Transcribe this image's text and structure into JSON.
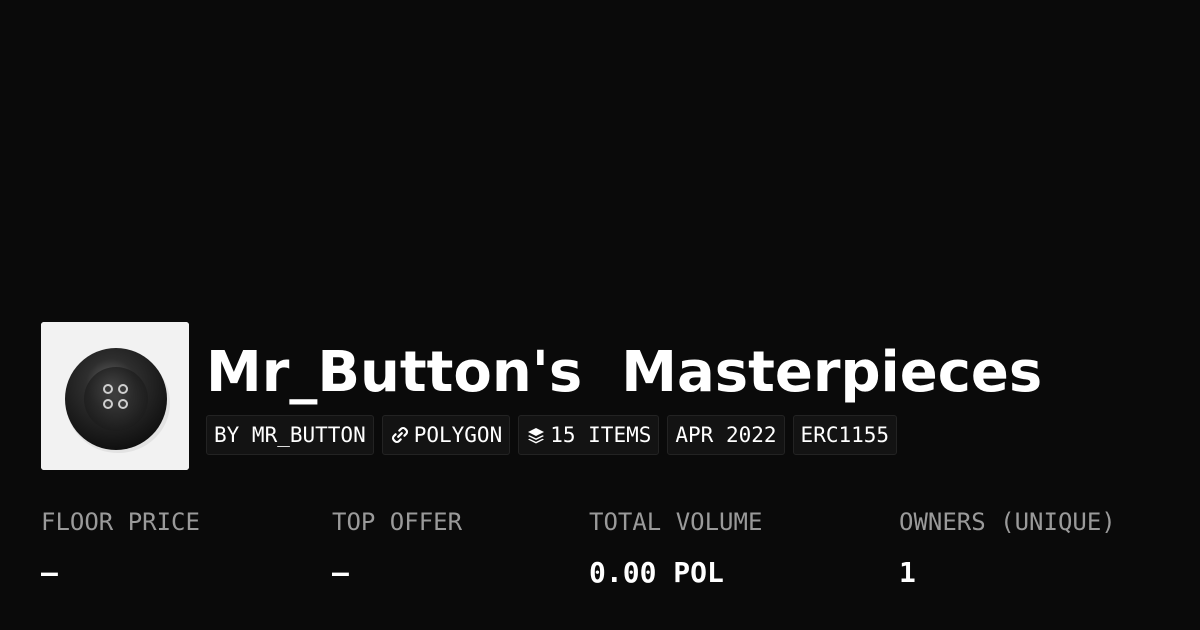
{
  "collection": {
    "name": "Mr_Button's  Masterpieces",
    "avatar_icon": "coat-button-icon"
  },
  "tags": [
    {
      "label": "BY MR_BUTTON",
      "icon": ""
    },
    {
      "label": "POLYGON",
      "icon": "chain-link-icon"
    },
    {
      "label": "15 ITEMS",
      "icon": "layers-icon"
    },
    {
      "label": "APR 2022",
      "icon": ""
    },
    {
      "label": "ERC1155",
      "icon": ""
    }
  ],
  "stats": [
    {
      "label": "FLOOR PRICE",
      "value": "–"
    },
    {
      "label": "TOP OFFER",
      "value": "–"
    },
    {
      "label": "TOTAL VOLUME",
      "value": "0.00 POL"
    },
    {
      "label": "OWNERS (UNIQUE)",
      "value": "1"
    }
  ],
  "colors": {
    "background": "#0a0a0a",
    "text_primary": "#ffffff",
    "text_secondary": "#9a9a9a",
    "tag_background": "#131313",
    "tag_border": "#232323"
  }
}
